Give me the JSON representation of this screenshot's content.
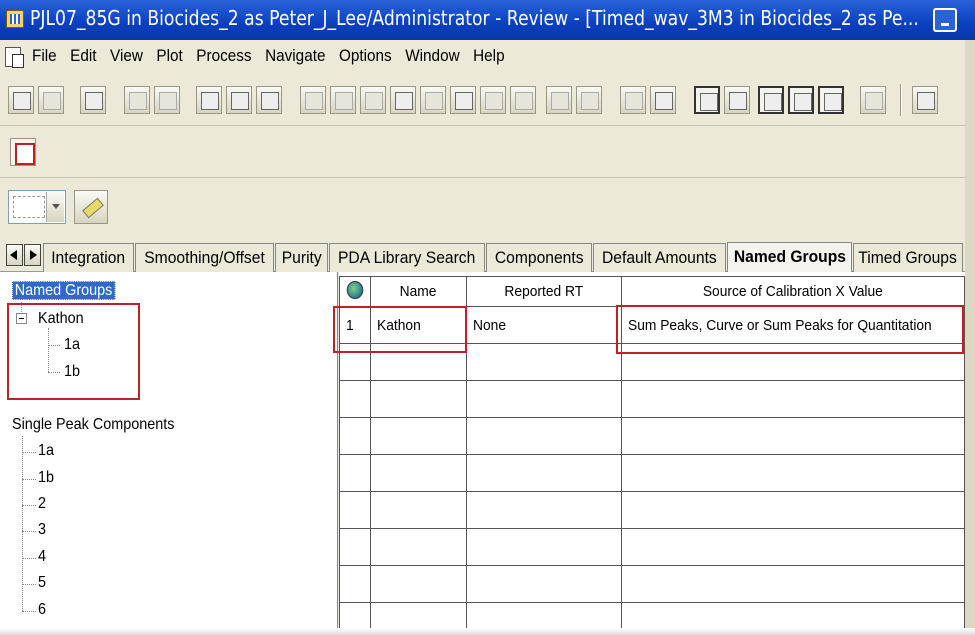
{
  "window": {
    "title": "PJL07_85G in Biocides_2 as Peter_J_Lee/Administrator - Review - [Timed_wav_3M3 in Biocides_2 as Pe..."
  },
  "menu": [
    "File",
    "Edit",
    "View",
    "Plot",
    "Process",
    "Navigate",
    "Options",
    "Window",
    "Help"
  ],
  "tabs": [
    {
      "label": "Integration",
      "active": false
    },
    {
      "label": "Smoothing/Offset",
      "active": false
    },
    {
      "label": "Purity",
      "active": false
    },
    {
      "label": "PDA Library Search",
      "active": false
    },
    {
      "label": "Components",
      "active": false
    },
    {
      "label": "Default Amounts",
      "active": false
    },
    {
      "label": "Named Groups",
      "active": true
    },
    {
      "label": "Timed Groups",
      "active": false
    }
  ],
  "tree": {
    "named_groups_label": "Named Groups",
    "group_name": "Kathon",
    "group_children": [
      "1a",
      "1b"
    ],
    "single_peak_label": "Single Peak Components",
    "single_peaks": [
      "1a",
      "1b",
      "2",
      "3",
      "4",
      "5",
      "6"
    ]
  },
  "grid": {
    "headers": {
      "name": "Name",
      "reported_rt": "Reported RT",
      "source": "Source of Calibration X Value"
    },
    "rows": [
      {
        "num": "1",
        "name": "Kathon",
        "reported_rt": "None",
        "source": "Sum Peaks, Curve or Sum Peaks for Quantitation"
      }
    ],
    "empty_rows": 8
  },
  "icons": {
    "app": "waveform-app-icon",
    "grid_corner": "globe-icon",
    "annotation_color": "#c0202a"
  }
}
